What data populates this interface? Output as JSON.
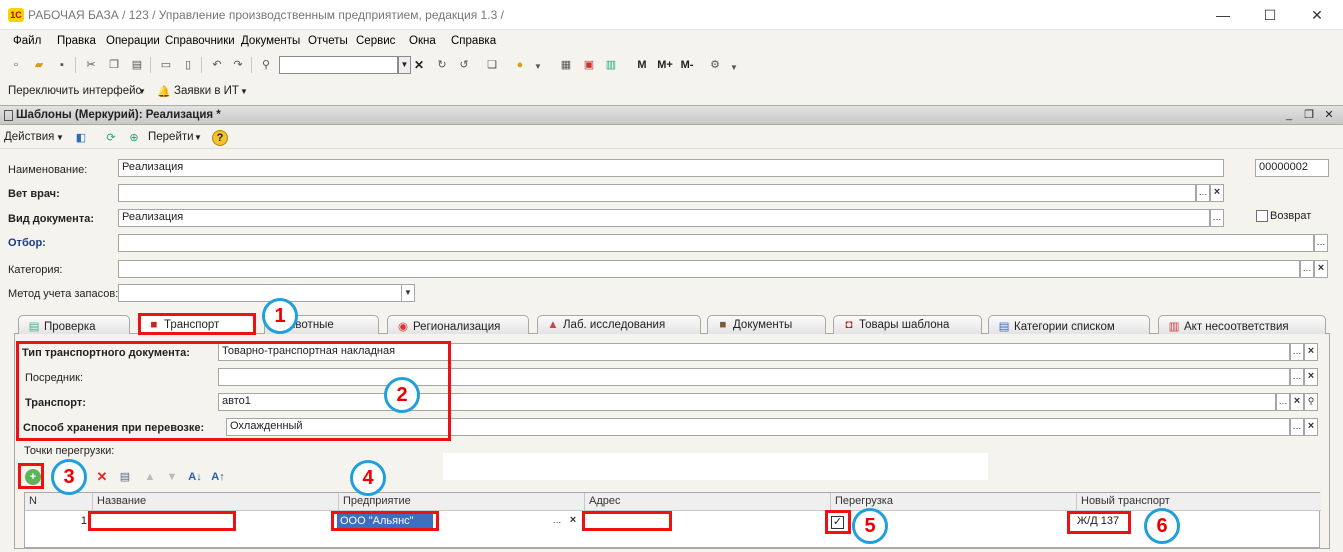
{
  "window": {
    "title": "РАБОЧАЯ БАЗА / 123 /  Управление производственным предприятием, редакция 1.3 /",
    "logo_text": "1С",
    "minimize": "—",
    "maximize": "☐",
    "close": "✕"
  },
  "menu": [
    "Файл",
    "Правка",
    "Операции",
    "Справочники",
    "Документы",
    "Отчеты",
    "Сервис",
    "Окна",
    "Справка"
  ],
  "toolbar": {
    "m_buttons": [
      "M",
      "M+",
      "M-"
    ]
  },
  "toolbar2": {
    "switch_interface": "Переключить интерфейс",
    "it_requests": "Заявки в ИТ"
  },
  "document": {
    "title": "Шаблоны (Меркурий): Реализация *",
    "actions": "Действия",
    "goto": "Перейти",
    "help": "?"
  },
  "form": {
    "name_label": "Наименование:",
    "name_value": "Реализация",
    "code_value": "00000002",
    "vet_label": "Вет врач:",
    "vet_value": "",
    "doctype_label": "Вид документа:",
    "doctype_value": "Реализация",
    "return_label": "Возврат",
    "filter_label": "Отбор:",
    "category_label": "Категория:",
    "stock_method_label": "Метод учета запасов:"
  },
  "tabs": [
    {
      "label": "Проверка",
      "icon": "check-icon"
    },
    {
      "label": "Транспорт",
      "icon": "truck-icon"
    },
    {
      "label": "ивотные",
      "icon": "animal-icon"
    },
    {
      "label": "Регионализация",
      "icon": "pin-icon"
    },
    {
      "label": "Лаб. исследования",
      "icon": "flask-icon"
    },
    {
      "label": "Документы",
      "icon": "briefcase-icon"
    },
    {
      "label": "Товары шаблона",
      "icon": "cart-icon"
    },
    {
      "label": "Категории списком",
      "icon": "list-icon"
    },
    {
      "label": "Акт несоответствия",
      "icon": "act-icon"
    }
  ],
  "transport": {
    "doc_type_label": "Тип транспортного документа:",
    "doc_type_value": "Товарно-транспортная накладная",
    "intermediary_label": "Посредник:",
    "intermediary_value": "",
    "transport_label": "Транспорт:",
    "transport_value": "авто1",
    "storage_label": "Способ хранения при перевозке:",
    "storage_value": "Охлажденный",
    "reload_points_label": "Точки перегрузки:"
  },
  "grid": {
    "columns": [
      "N",
      "Название",
      "Предприятие",
      "Адрес",
      "Перегрузка",
      "Новый транспорт"
    ],
    "rows": [
      {
        "n": "1",
        "name": "",
        "enterprise": "ООО \"Альянс\"",
        "address": "",
        "reload": true,
        "new_transport": "Ж/Д 137"
      }
    ]
  },
  "annotations": [
    "1",
    "2",
    "3",
    "4",
    "5",
    "6"
  ]
}
